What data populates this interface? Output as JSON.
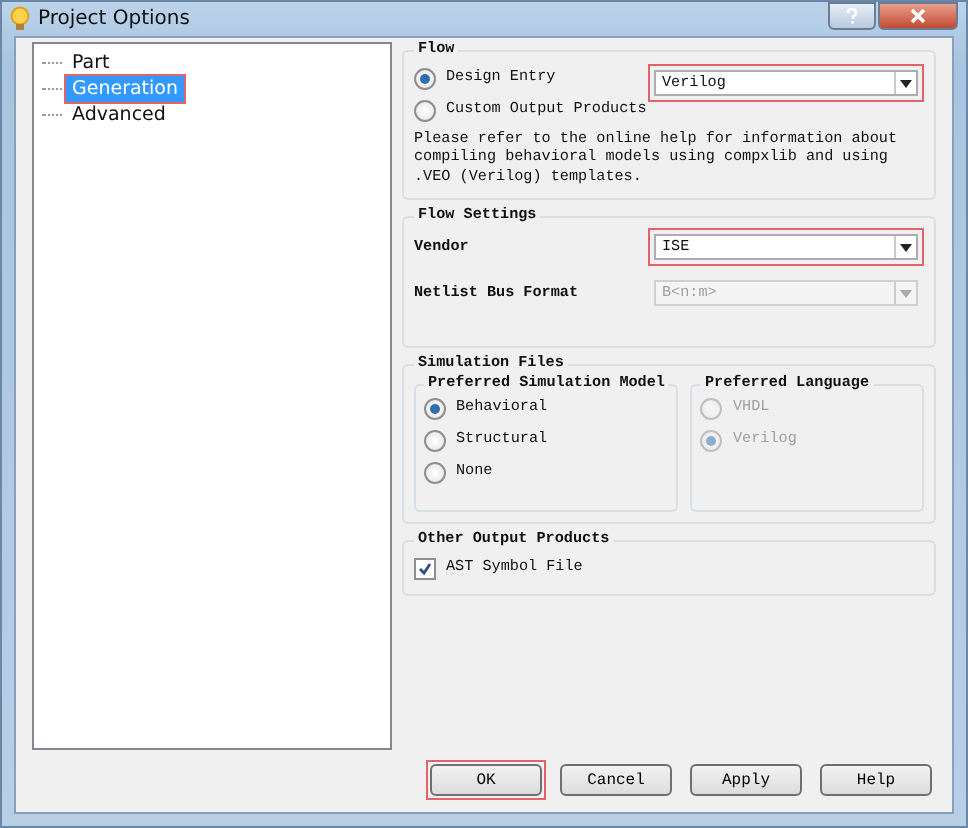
{
  "window": {
    "title": "Project Options"
  },
  "tree": {
    "items": [
      {
        "label": "Part",
        "selected": false,
        "highlighted": false
      },
      {
        "label": "Generation",
        "selected": true,
        "highlighted": true
      },
      {
        "label": "Advanced",
        "selected": false,
        "highlighted": false
      }
    ]
  },
  "flow": {
    "title": "Flow",
    "options": [
      {
        "label": "Design Entry",
        "selected": true
      },
      {
        "label": "Custom Output Products",
        "selected": false
      }
    ],
    "design_entry": {
      "value": "Verilog",
      "highlighted": true,
      "disabled": false
    },
    "note": "Please refer to the online help for information about compiling behavioral models using compxlib and using .VEO (Verilog) templates."
  },
  "flow_settings": {
    "title": "Flow Settings",
    "fields": [
      {
        "label": "Vendor",
        "value": "ISE",
        "highlighted": true,
        "disabled": false
      },
      {
        "label": "Netlist Bus Format",
        "value": "B<n:m>",
        "highlighted": false,
        "disabled": true
      }
    ]
  },
  "simulation_files": {
    "title": "Simulation Files",
    "model": {
      "title": "Preferred Simulation Model",
      "options": [
        {
          "label": "Behavioral",
          "selected": true,
          "disabled": false
        },
        {
          "label": "Structural",
          "selected": false,
          "disabled": false
        },
        {
          "label": "None",
          "selected": false,
          "disabled": false
        }
      ]
    },
    "language": {
      "title": "Preferred Language",
      "options": [
        {
          "label": "VHDL",
          "selected": false,
          "disabled": true
        },
        {
          "label": "Verilog",
          "selected": true,
          "disabled": true
        }
      ]
    }
  },
  "other_output": {
    "title": "Other Output Products",
    "checkboxes": [
      {
        "label": "AST Symbol File",
        "checked": true
      }
    ]
  },
  "buttons": [
    {
      "label": "OK",
      "highlighted": true
    },
    {
      "label": "Cancel",
      "highlighted": false
    },
    {
      "label": "Apply",
      "highlighted": false
    },
    {
      "label": "Help",
      "highlighted": false
    }
  ]
}
